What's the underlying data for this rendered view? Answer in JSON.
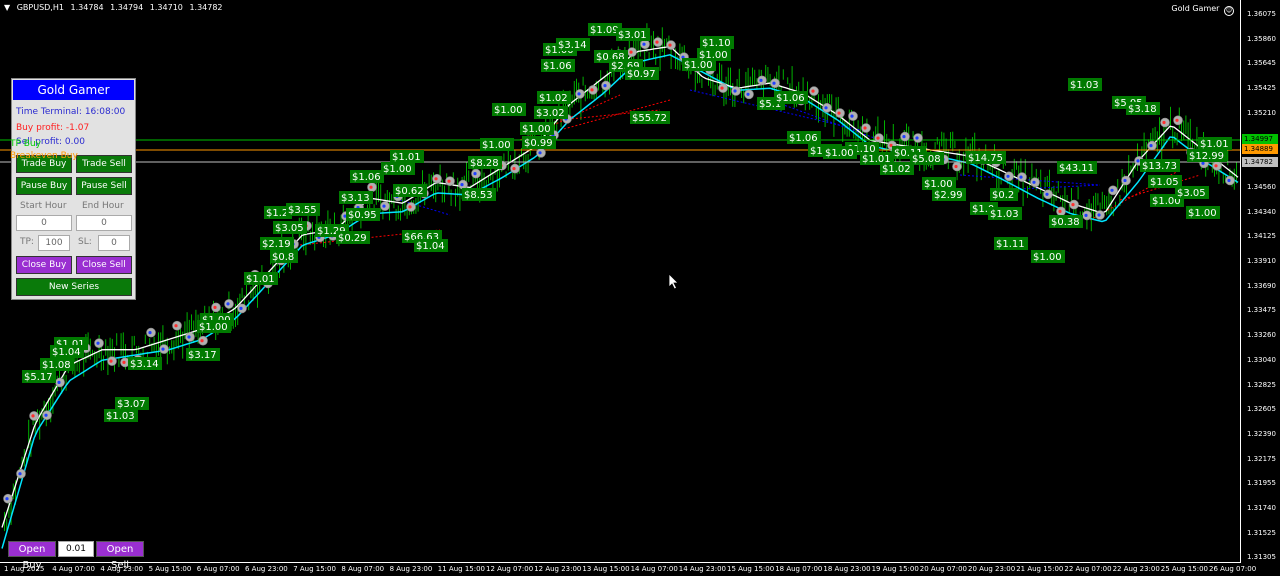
{
  "header": {
    "symbol": "GBPUSD,H1",
    "ohlc": [
      "1.34784",
      "1.34794",
      "1.34710",
      "1.34782"
    ],
    "ea_name": "Gold Gamer"
  },
  "colors": {
    "ema_fast": "#ffffff",
    "ema_slow": "#00e5ff",
    "candles": "#00b000",
    "label_bg": "#007a00",
    "buy_line": "#00c000",
    "breakeven_line": "#ff9900",
    "bid_line": "#c0c0c0",
    "trend_blue": "#0000ff",
    "trend_red": "#ff0000"
  },
  "price_axis": {
    "labels": [
      "1.36075",
      "1.35860",
      "1.35645",
      "1.35425",
      "1.35210",
      "1.34995",
      "1.34780",
      "1.34560",
      "1.34340",
      "1.34125",
      "1.33910",
      "1.33690",
      "1.33475",
      "1.33260",
      "1.33040",
      "1.32825",
      "1.32605",
      "1.32390",
      "1.32175",
      "1.31955",
      "1.31740",
      "1.31525",
      "1.31305"
    ],
    "current_tags": [
      {
        "text": "1.34997",
        "color": "#00c000"
      },
      {
        "text": "1.34889",
        "color": "#ff9900"
      },
      {
        "text": "1.34782",
        "color": "#c0c0c0"
      }
    ]
  },
  "time_axis": {
    "labels": [
      "1 Aug 2025",
      "4 Aug 07:00",
      "4 Aug 23:00",
      "5 Aug 15:00",
      "6 Aug 07:00",
      "6 Aug 23:00",
      "7 Aug 15:00",
      "8 Aug 07:00",
      "8 Aug 23:00",
      "11 Aug 15:00",
      "12 Aug 07:00",
      "12 Aug 23:00",
      "13 Aug 15:00",
      "14 Aug 07:00",
      "14 Aug 23:00",
      "15 Aug 15:00",
      "18 Aug 07:00",
      "18 Aug 23:00",
      "19 Aug 15:00",
      "20 Aug 07:00",
      "20 Aug 23:00",
      "21 Aug 15:00",
      "22 Aug 07:00",
      "22 Aug 23:00",
      "25 Aug 15:00",
      "26 Aug 07:00"
    ]
  },
  "panel": {
    "title": "Gold Gamer",
    "time_terminal": "Time Terminal: 16:08:00",
    "buy_profit": "Buy profit: -1.07",
    "sell_profit": "Sell profit: 0.00",
    "tp_buy_overlay": "TP Buy",
    "breakeven_overlay": "Breakeven Buy",
    "trade_buy": "Trade Buy",
    "trade_sell": "Trade Sell",
    "pause_buy": "Pause Buy",
    "pause_sell": "Pause Sell",
    "start_hour_label": "Start Hour",
    "end_hour_label": "End Hour",
    "start_hour_value": "0",
    "end_hour_value": "0",
    "tp_label": "TP:",
    "tp_value": "100",
    "sl_label": "SL:",
    "sl_value": "0",
    "close_buy": "Close Buy",
    "close_sell": "Close Sell",
    "new_series": "New Series"
  },
  "bottom": {
    "open_buy": "Open Buy",
    "lot": "0.01",
    "open_sell": "Open Sell"
  },
  "chart_data": {
    "type": "candlestick",
    "symbol": "GBPUSD",
    "timeframe": "H1",
    "ylim": [
      1.312,
      1.3621
    ],
    "ema_fast": [
      1.313,
      1.323,
      1.3285,
      1.33,
      1.33,
      1.331,
      1.332,
      1.334,
      1.3375,
      1.341,
      1.3415,
      1.3445,
      1.344,
      1.346,
      1.3455,
      1.3475,
      1.3495,
      1.3535,
      1.356,
      1.3585,
      1.359,
      1.356,
      1.355,
      1.3555,
      1.3545,
      1.3525,
      1.35,
      1.3495,
      1.349,
      1.3485,
      1.347,
      1.3455,
      1.344,
      1.343,
      1.348,
      1.3515,
      1.349,
      1.3465
    ],
    "ema_slow": [
      1.311,
      1.322,
      1.327,
      1.329,
      1.3295,
      1.33,
      1.331,
      1.333,
      1.3365,
      1.34,
      1.341,
      1.343,
      1.3432,
      1.345,
      1.3448,
      1.3465,
      1.3485,
      1.352,
      1.3545,
      1.3575,
      1.3582,
      1.3565,
      1.3548,
      1.355,
      1.354,
      1.352,
      1.3495,
      1.3488,
      1.3485,
      1.3478,
      1.3462,
      1.3445,
      1.343,
      1.3422,
      1.346,
      1.3505,
      1.348,
      1.346
    ],
    "trade_labels": [
      "$5.17",
      "$1.01",
      "$1.04",
      "$1.08",
      "$3.14",
      "$3.07",
      "$1.03",
      "$3.17",
      "$1.00",
      "$1.00",
      "$1.01",
      "$2.19",
      "$0.8",
      "$3.05",
      "$1.2",
      "$3.55",
      "$1.29",
      "$0.29",
      "$3.13",
      "$1.06",
      "$0.95",
      "$1.01",
      "$1.00",
      "$0.62",
      "$66.63",
      "$1.04",
      "$8.53",
      "$1.00",
      "$8.28",
      "$1.00",
      "$1.00",
      "$0.99",
      "$3.02",
      "$1.02",
      "$1.06",
      "$1.00",
      "$3.14",
      "$1.09",
      "$3.01",
      "$0.68",
      "$2.69",
      "$0.97",
      "$55.72",
      "$1.00",
      "$1.00",
      "$1.10",
      "$5.1",
      "$1.06",
      "$1.06",
      "$1.00",
      "$1.10",
      "$1.00",
      "$1.01",
      "$1.02",
      "$0.11",
      "$5.08",
      "$1.00",
      "$2.99",
      "$14.75",
      "$0.2",
      "$1.0",
      "$1.03",
      "$1.11",
      "$0.38",
      "$1.00",
      "$43.11",
      "$1.03",
      "$5.05",
      "$3.18",
      "$13.73",
      "$1.05",
      "$1.00",
      "$3.05",
      "$12.99",
      "$1.01",
      "$1.00"
    ]
  }
}
